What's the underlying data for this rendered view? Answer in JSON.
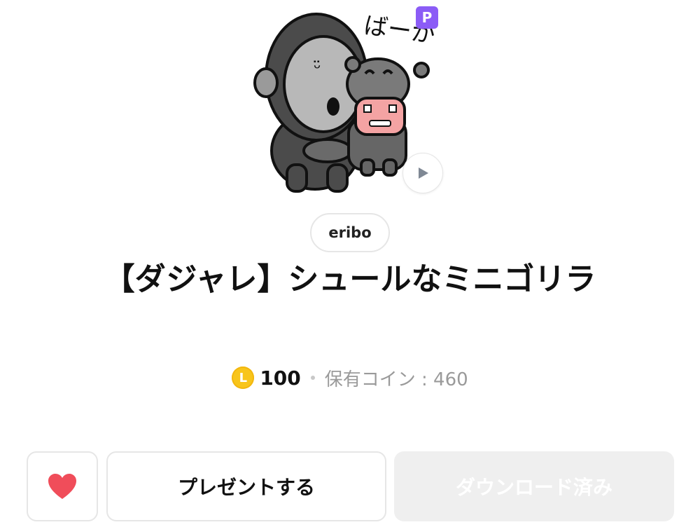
{
  "sticker": {
    "bubble_text": "ばーか",
    "premium_badge": "P",
    "play_icon": "play-icon"
  },
  "author": {
    "name": "eribo"
  },
  "title": "【ダジャレ】シュールなミニゴリラ",
  "price": {
    "coin_icon_label": "L",
    "amount": "100",
    "owned_coins": "保有コイン : 460",
    "coin_color": "#f8c51b"
  },
  "actions": {
    "favorite_icon": "heart-icon",
    "gift_label": "プレゼントする",
    "download_label": "ダウンロード済み",
    "heart_color": "#f04d5a"
  }
}
